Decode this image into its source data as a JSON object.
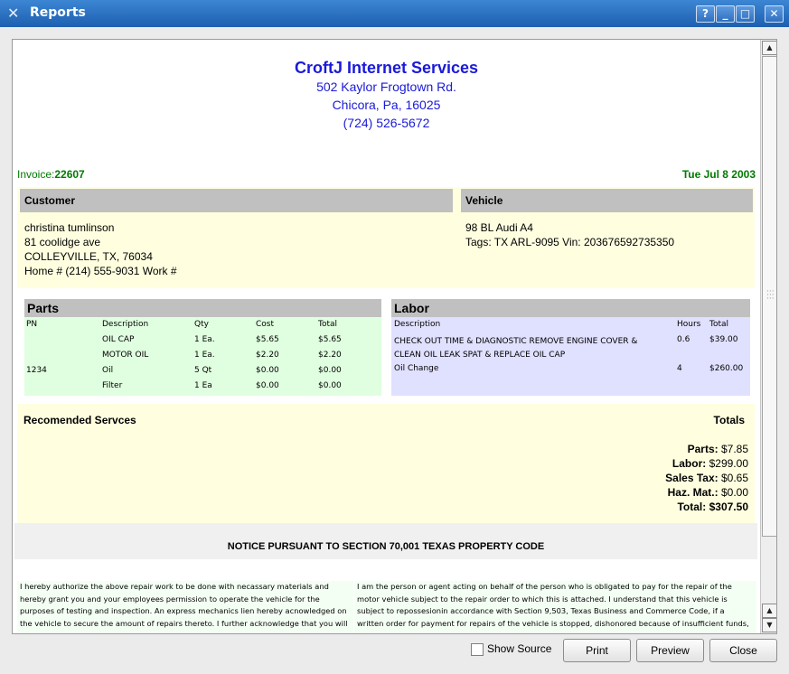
{
  "window": {
    "title": "Reports",
    "buttons": [
      "?",
      "_",
      "□",
      "✕"
    ]
  },
  "company": {
    "name": "CroftJ Internet Services",
    "street": "502 Kaylor Frogtown Rd.",
    "city": "Chicora, Pa, 16025",
    "phone": "(724) 526-5672"
  },
  "invoice": {
    "label": "Invoice:",
    "number": "22607",
    "date": "Tue Jul 8 2003"
  },
  "customer": {
    "header": "Customer",
    "lines": [
      "christina tumlinson",
      "81 coolidge ave",
      "COLLEYVILLE, TX, 76034",
      "Home # (214) 555-9031 Work #"
    ]
  },
  "vehicle": {
    "header": "Vehicle",
    "lines": [
      "98 BL Audi A4",
      "Tags: TX ARL-9095 Vin: 203676592735350"
    ]
  },
  "parts": {
    "header": "Parts",
    "columns": [
      "PN",
      "Description",
      "Qty",
      "Cost",
      "Total"
    ],
    "rows": [
      [
        "",
        "OIL CAP",
        "1 Ea.",
        "$5.65",
        "$5.65"
      ],
      [
        "",
        "MOTOR OIL",
        "1 Ea.",
        "$2.20",
        "$2.20"
      ],
      [
        "1234",
        "Oil",
        "5 Qt",
        "$0.00",
        "$0.00"
      ],
      [
        "",
        "Filter",
        "1 Ea",
        "$0.00",
        "$0.00"
      ]
    ]
  },
  "labor": {
    "header": "Labor",
    "columns": [
      "Description",
      "Hours",
      "Total"
    ],
    "rows": [
      {
        "desc1": "CHECK OUT TIME & DIAGNOSTIC REMOVE ENGINE COVER &",
        "desc2": "CLEAN OIL LEAK SPAT & REPLACE OIL CAP",
        "hours": "0.6",
        "total": "$39.00"
      },
      {
        "desc1": "Oil Change",
        "desc2": "",
        "hours": "4",
        "total": "$260.00"
      }
    ]
  },
  "recommended": {
    "label": "Recomended Servces"
  },
  "totals": {
    "header": "Totals",
    "items": [
      {
        "label": "Parts:",
        "value": "$7.85"
      },
      {
        "label": "Labor:",
        "value": "$299.00"
      },
      {
        "label": "Sales Tax:",
        "value": "$0.65"
      },
      {
        "label": "Haz. Mat.:",
        "value": "$0.00"
      },
      {
        "label": "Total:",
        "value": "$307.50"
      }
    ]
  },
  "notice": {
    "title": "NOTICE PURSUANT TO SECTION 70,001 TEXAS PROPERTY CODE",
    "left": [
      "I hereby authorize the above repair work to be done with necassary materials and",
      "hereby grant you and your employees permission to operate the vehicle for the",
      "purposes of testing and inspection. An express mechanics lien hereby acnowledged on",
      "the vehicle to secure the amount of repairs thereto. I further acknowledge that you will"
    ],
    "right": [
      "I am the person or agent acting on behalf of the person who is obligated to pay for the repair of the",
      "motor vehicle subject to the repair order to which this is attached. I understand that this vehicle is",
      "subject to repossesionin accordance with Section 9,503, Texas Business and Commerce Code, if a",
      "written order for payment for repairs of the vehicle is stopped, dishonored because of insufficient funds,"
    ]
  },
  "footer": {
    "show_source_label": "Show Source",
    "show_source_checked": false,
    "print_label": "Print",
    "preview_label": "Preview",
    "close_label": "Close"
  }
}
